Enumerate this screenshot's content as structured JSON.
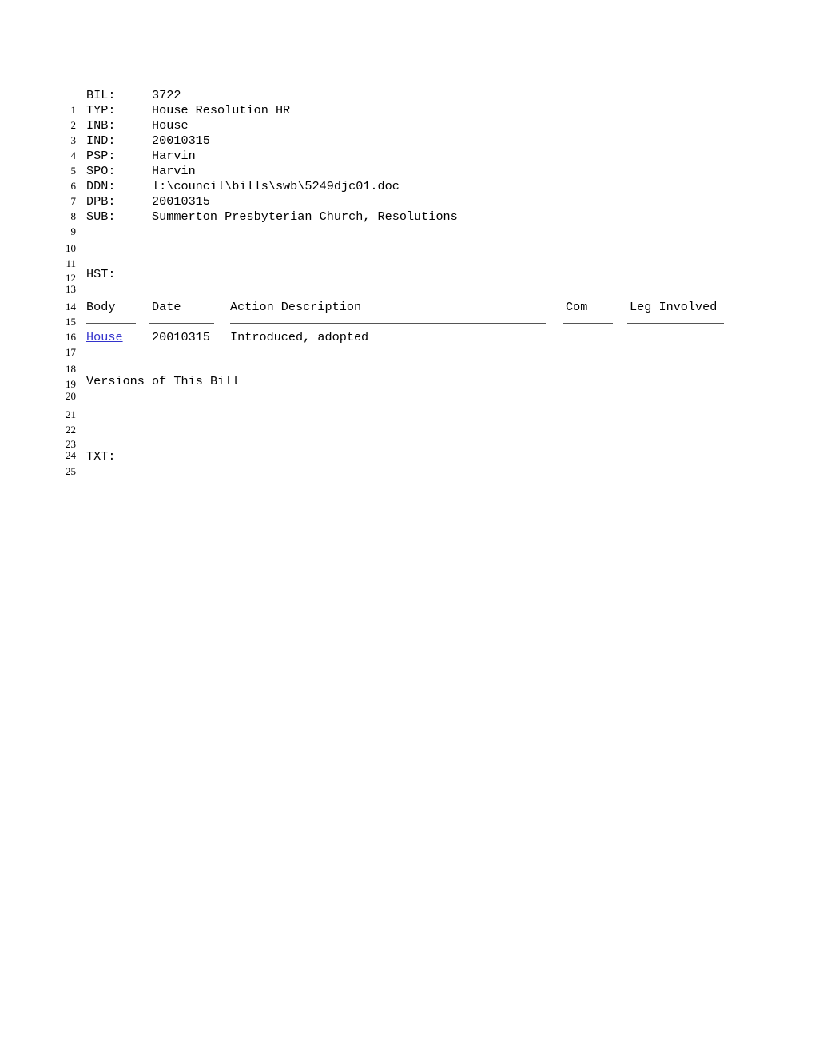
{
  "document": {
    "line_count": 25,
    "link_color": "#3333cc",
    "text_color": "#000000",
    "background_color": "#ffffff"
  },
  "fields": {
    "bil": {
      "key": "BIL:",
      "value": "3722"
    },
    "typ": {
      "key": "TYP:",
      "value": "House Resolution HR"
    },
    "inb": {
      "key": "INB:",
      "value": "House"
    },
    "ind": {
      "key": "IND:",
      "value": "20010315"
    },
    "psp": {
      "key": "PSP:",
      "value": "Harvin"
    },
    "spo": {
      "key": "SPO:",
      "value": "Harvin"
    },
    "ddn": {
      "key": "DDN:",
      "value": "l:\\council\\bills\\swb\\5249djc01.doc"
    },
    "dpb": {
      "key": "DPB:",
      "value": "20010315"
    },
    "sub": {
      "key": "SUB:",
      "value": "Summerton Presbyterian Church, Resolutions"
    }
  },
  "sections": {
    "hst_label": "HST:",
    "versions_label": "Versions of This Bill",
    "txt_label": "TXT:"
  },
  "history_table": {
    "headers": {
      "body": "Body",
      "date": "Date",
      "action": "Action Description",
      "com": "Com",
      "leg": "Leg Involved"
    },
    "rows": [
      {
        "body": "House",
        "date": "20010315",
        "action": "Introduced, adopted",
        "com": "",
        "leg": ""
      }
    ]
  },
  "line_numbers": {
    "n1": "1",
    "n2": "2",
    "n3": "3",
    "n4": "4",
    "n5": "5",
    "n6": "6",
    "n7": "7",
    "n8": "8",
    "n9": "9",
    "n10": "10",
    "n11": "11",
    "n12": "12",
    "n13": "13",
    "n14": "14",
    "n15": "15",
    "n16": "16",
    "n17": "17",
    "n18": "18",
    "n19": "19",
    "n20": "20",
    "n21": "21",
    "n22": "22",
    "n23": "23",
    "n24": "24",
    "n25": "25"
  }
}
